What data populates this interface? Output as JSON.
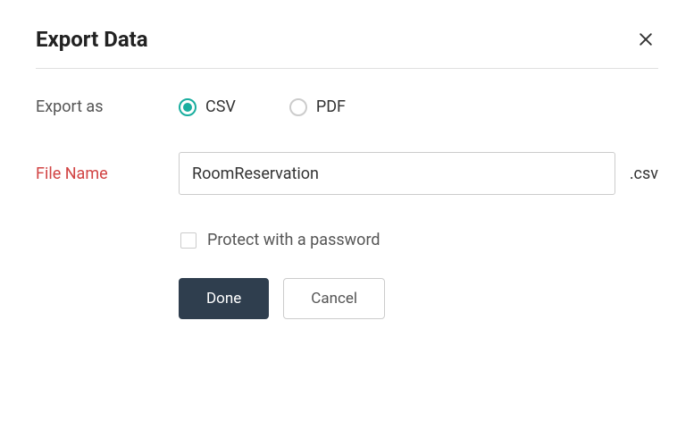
{
  "dialog": {
    "title": "Export Data"
  },
  "form": {
    "export_as_label": "Export as",
    "radio_options": {
      "csv": "CSV",
      "pdf": "PDF"
    },
    "filename_label": "File Name",
    "filename_value": "RoomReservation",
    "file_extension": ".csv",
    "protect_label": "Protect with a password"
  },
  "buttons": {
    "done": "Done",
    "cancel": "Cancel"
  }
}
